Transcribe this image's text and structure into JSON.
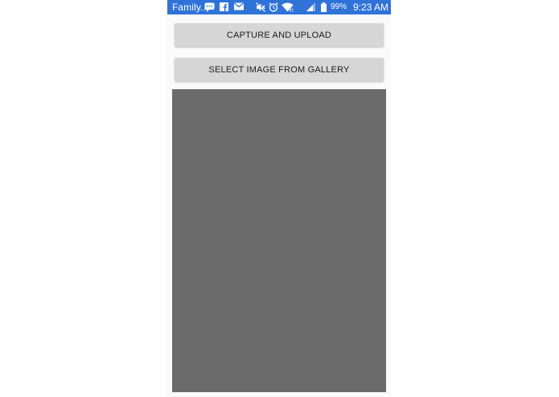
{
  "status_bar": {
    "carrier": "Family..",
    "battery": "99%",
    "time": "9:23 AM",
    "background": "#2f73d9",
    "icons": [
      "chat-bubble-icon",
      "facebook-icon",
      "mail-icon",
      "mute-icon",
      "alarm-icon",
      "wifi-icon",
      "signal-icon",
      "battery-icon"
    ]
  },
  "actions": {
    "capture_label": "CAPTURE AND UPLOAD",
    "gallery_label": "SELECT IMAGE FROM GALLERY"
  },
  "preview": {
    "color": "#6b6b6b"
  }
}
